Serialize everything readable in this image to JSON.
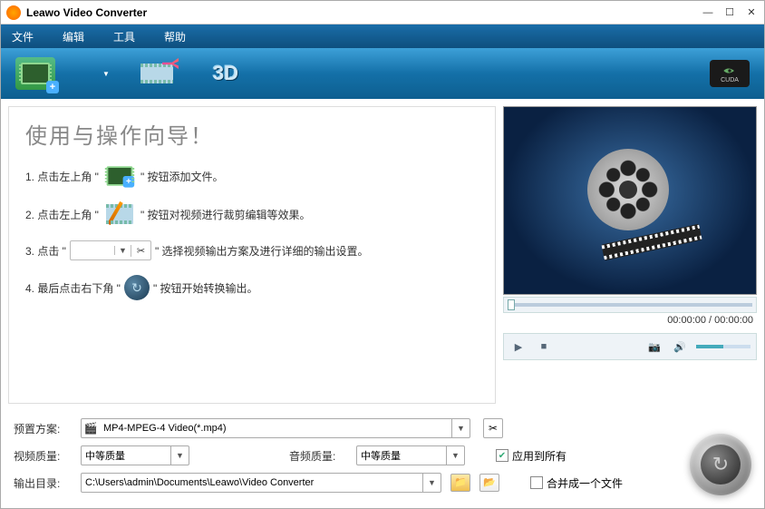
{
  "title": "Leawo Video Converter",
  "menu": [
    "文件",
    "编辑",
    "工具",
    "帮助"
  ],
  "cuda": {
    "brand": "NVIDIA",
    "tech": "CUDA"
  },
  "guide": {
    "title": "使用与操作向导！",
    "s1a": "1. 点击左上角 \"",
    "s1b": "\" 按钮添加文件。",
    "s2a": "2. 点击左上角 \"",
    "s2b": "\" 按钮对视频进行裁剪编辑等效果。",
    "s3a": "3. 点击 \"",
    "s3b": "\" 选择视频输出方案及进行详细的输出设置。",
    "s4a": "4. 最后点击右下角 \"",
    "s4b": "\" 按钮开始转换输出。"
  },
  "preview": {
    "time": "00:00:00 / 00:00:00"
  },
  "settings": {
    "profile_label": "预置方案:",
    "profile_value": "MP4-MPEG-4 Video(*.mp4)",
    "vquality_label": "视频质量:",
    "vquality_value": "中等质量",
    "aquality_label": "音频质量:",
    "aquality_value": "中等质量",
    "apply_all": "应用到所有",
    "output_label": "输出目录:",
    "output_value": "C:\\Users\\admin\\Documents\\Leawo\\Video Converter",
    "merge": "合并成一个文件"
  }
}
